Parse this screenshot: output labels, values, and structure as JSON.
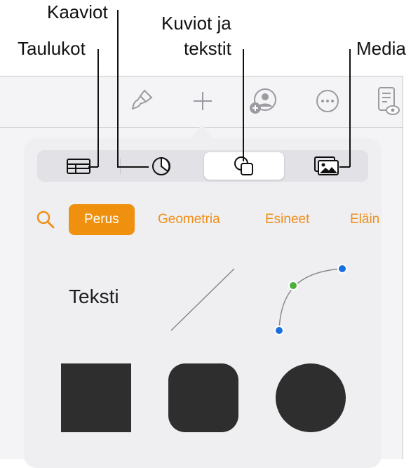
{
  "callouts": {
    "kaaviot": "Kaaviot",
    "taulukot": "Taulukot",
    "kuviot_line1": "Kuviot ja",
    "kuviot_line2": "tekstit",
    "media": "Media"
  },
  "toolbar": {
    "icons": [
      "paintbrush-icon",
      "plus-icon",
      "add-collaborator-icon",
      "more-icon",
      "document-view-icon"
    ]
  },
  "insert_tabs": [
    "table-icon",
    "chart-icon",
    "shape-icon",
    "media-icon"
  ],
  "active_tab": "shape-icon",
  "categories": {
    "items": [
      "Perus",
      "Geometria",
      "Esineet",
      "Eläin"
    ],
    "selected": "Perus"
  },
  "shapes": {
    "text_label": "Teksti"
  },
  "colors": {
    "accent": "#f0900f",
    "shape_fill": "#2e2e2e",
    "handle_blue": "#1a6fe0",
    "handle_green": "#4caf3a"
  }
}
